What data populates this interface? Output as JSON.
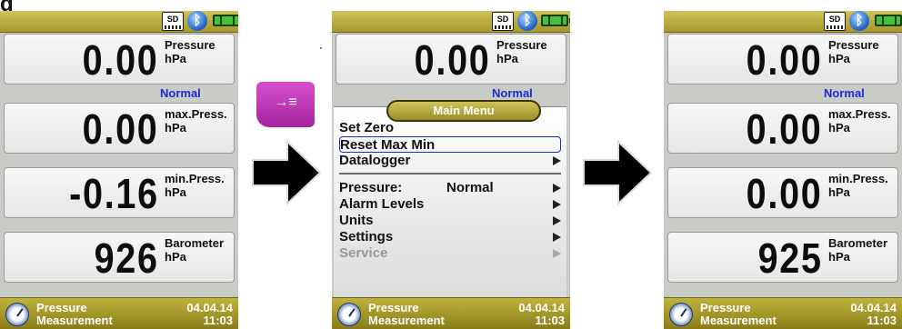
{
  "page_title_fragment": "g",
  "key_label": "→≡",
  "screens": [
    {
      "status_icons": [
        "sd-card-icon",
        "bluetooth-icon",
        "battery-icon"
      ],
      "sd_label": "SD",
      "rows": [
        {
          "value": "0.00",
          "label": "Pressure",
          "unit": "hPa",
          "status": "Normal"
        },
        {
          "value": "0.00",
          "label": "max.Press.",
          "unit": "hPa"
        },
        {
          "value": "-0.16",
          "label": "min.Press.",
          "unit": "hPa"
        },
        {
          "value": "926",
          "label": "Barometer",
          "unit": "hPa"
        }
      ],
      "bottom": {
        "mode_line1": "Pressure",
        "mode_line2": "Measurement",
        "date": "04.04.14",
        "time": "11:03"
      }
    },
    {
      "sd_label": "SD",
      "rows": [
        {
          "value": "0.00",
          "label": "Pressure",
          "unit": "hPa",
          "status": "Normal"
        }
      ],
      "menu": {
        "title": "Main Menu",
        "items": [
          {
            "label": "Set Zero",
            "submenu": false,
            "selected": false,
            "disabled": false
          },
          {
            "label": "Reset Max Min",
            "submenu": false,
            "selected": true,
            "disabled": false
          },
          {
            "label": "Datalogger",
            "submenu": true,
            "selected": false,
            "disabled": false
          },
          {
            "label": "Pressure:",
            "value": "Normal",
            "submenu": true,
            "selected": false,
            "disabled": false
          },
          {
            "label": "Alarm Levels",
            "submenu": true,
            "selected": false,
            "disabled": false
          },
          {
            "label": "Units",
            "submenu": true,
            "selected": false,
            "disabled": false
          },
          {
            "label": "Settings",
            "submenu": true,
            "selected": false,
            "disabled": false
          },
          {
            "label": "Service",
            "submenu": true,
            "selected": false,
            "disabled": true
          }
        ]
      },
      "bottom": {
        "mode_line1": "Pressure",
        "mode_line2": "Measurement",
        "date": "04.04.14",
        "time": "11:03"
      }
    },
    {
      "sd_label": "SD",
      "rows": [
        {
          "value": "0.00",
          "label": "Pressure",
          "unit": "hPa",
          "status": "Normal"
        },
        {
          "value": "0.00",
          "label": "max.Press.",
          "unit": "hPa"
        },
        {
          "value": "0.00",
          "label": "min.Press.",
          "unit": "hPa"
        },
        {
          "value": "925",
          "label": "Barometer",
          "unit": "hPa"
        }
      ],
      "bottom": {
        "mode_line1": "Pressure",
        "mode_line2": "Measurement",
        "date": "04.04.14",
        "time": "11:03"
      }
    }
  ],
  "colors": {
    "status_bar": "#bfb23c",
    "status_text": "#1b2bd6",
    "key": "#c23bbd",
    "selection": "#1a2ed0"
  }
}
